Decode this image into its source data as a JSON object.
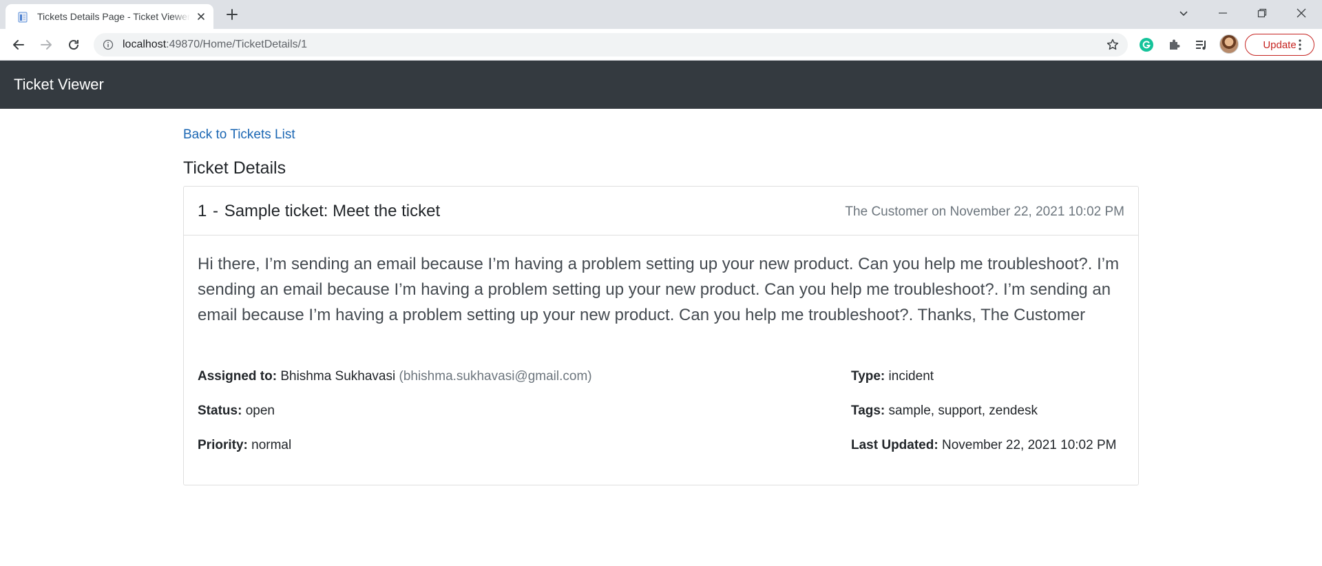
{
  "browser": {
    "tab_title": "Tickets Details Page - Ticket Viewer",
    "url_host": "localhost",
    "url_path": ":49870/Home/TicketDetails/1",
    "update_label": "Update",
    "colors": {
      "tabstrip": "#dee1e6",
      "update": "#c5221f",
      "grammarly": "#15c39a"
    }
  },
  "navbar": {
    "brand": "Ticket Viewer",
    "background": "#343a40"
  },
  "page": {
    "back_link": "Back to Tickets List",
    "section_title": "Ticket Details",
    "link_color": "#1a66b3"
  },
  "ticket": {
    "id": "1",
    "subject": "Sample ticket: Meet the ticket",
    "requester": "The Customer",
    "created_prefix": "on",
    "created_at": "November 22, 2021 10:02 PM",
    "description": "Hi there, I’m sending an email because I’m having a problem setting up your new product. Can you help me troubleshoot?. I’m sending an email because I’m having a problem setting up your new product. Can you help me troubleshoot?. I’m sending an email because I’m having a problem setting up your new product. Can you help me troubleshoot?. Thanks, The Customer",
    "fields": {
      "assigned_label": "Assigned to:",
      "assignee_name": "Bhishma Sukhavasi",
      "assignee_email": "(bhishma.sukhavasi@gmail.com)",
      "status_label": "Status:",
      "status": "open",
      "priority_label": "Priority:",
      "priority": "normal",
      "type_label": "Type:",
      "type": "incident",
      "tags_label": "Tags:",
      "tags": "sample, support, zendesk",
      "updated_label": "Last Updated:",
      "updated_at": "November 22, 2021 10:02 PM"
    }
  }
}
